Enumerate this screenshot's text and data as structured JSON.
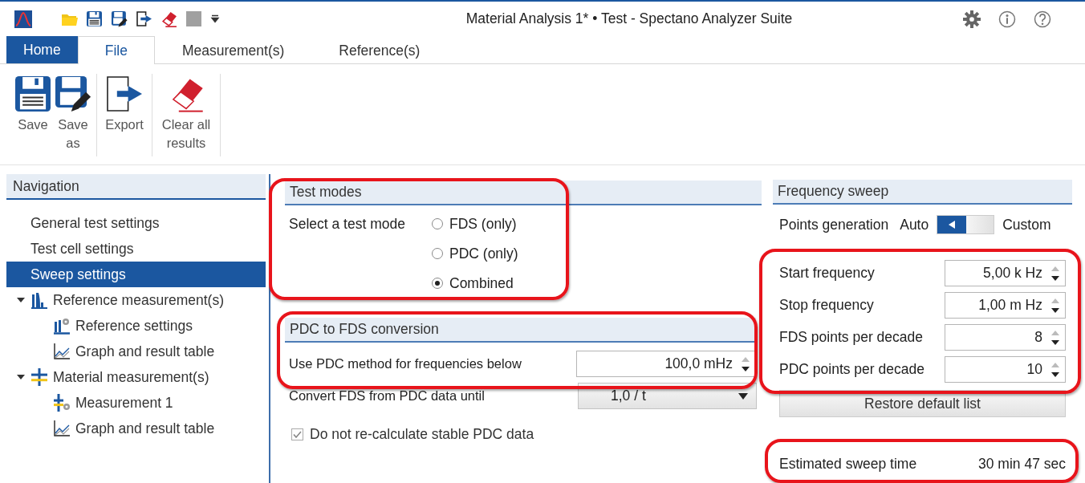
{
  "window": {
    "title": "Material Analysis 1* • Test - Spectano Analyzer Suite"
  },
  "tabs": [
    {
      "label": "Home",
      "selected": false,
      "kind": "app"
    },
    {
      "label": "File",
      "selected": true,
      "kind": "tab"
    },
    {
      "label": "Measurement(s)",
      "selected": false,
      "kind": "tab"
    },
    {
      "label": "Reference(s)",
      "selected": false,
      "kind": "tab"
    }
  ],
  "ribbon": {
    "groups": [
      {
        "buttons": [
          {
            "label": "Save",
            "kind": "save"
          },
          {
            "label": "Save as",
            "kind": "save-as"
          }
        ]
      },
      {
        "buttons": [
          {
            "label": "Export",
            "kind": "export"
          }
        ]
      },
      {
        "buttons": [
          {
            "label": "Clear all results",
            "kind": "clear"
          }
        ]
      }
    ]
  },
  "navigation": {
    "title": "Navigation",
    "items": [
      {
        "label": "General test settings",
        "selected": false
      },
      {
        "label": "Test cell settings",
        "selected": false
      },
      {
        "label": "Sweep settings",
        "selected": true
      },
      {
        "label": "Reference measurement(s)",
        "kind": "reference",
        "selected": false,
        "expanded": true,
        "children": [
          {
            "label": "Reference settings",
            "kind": "reference-settings",
            "selected": false
          },
          {
            "label": "Graph and result table",
            "kind": "graph",
            "selected": false
          }
        ]
      },
      {
        "label": "Material measurement(s)",
        "kind": "material",
        "selected": false,
        "expanded": true,
        "children": [
          {
            "label": "Measurement 1",
            "kind": "measurement",
            "selected": false
          },
          {
            "label": "Graph and result table",
            "kind": "graph",
            "selected": false
          }
        ]
      }
    ]
  },
  "test_modes": {
    "title": "Test modes",
    "label": "Select a test mode",
    "options": [
      {
        "label": "FDS (only)",
        "selected": false
      },
      {
        "label": "PDC (only)",
        "selected": false
      },
      {
        "label": "Combined",
        "selected": true
      }
    ]
  },
  "pdc_conversion": {
    "title": "PDC to FDS conversion",
    "fields": [
      {
        "label": "Use PDC method for frequencies below",
        "value": "100,0 mHz",
        "kind": "spin"
      },
      {
        "label": "Convert FDS from PDC data until",
        "value": "1,0 / t",
        "kind": "dropdown"
      }
    ],
    "checkbox": {
      "label": "Do not re-calculate stable PDC data",
      "checked": true,
      "disabled": true
    }
  },
  "frequency_sweep": {
    "title": "Frequency sweep",
    "points_generation": {
      "label": "Points generation",
      "off_label": "Auto",
      "on_label": "Custom",
      "on": false
    },
    "fields": [
      {
        "label": "Start frequency",
        "value": "5,00 k Hz"
      },
      {
        "label": "Stop frequency",
        "value": "1,00 m Hz"
      },
      {
        "label": "FDS points per decade",
        "value": "8"
      },
      {
        "label": "PDC points per decade",
        "value": "10"
      }
    ],
    "restore_button": "Restore default list",
    "estimated": {
      "label": "Estimated sweep time",
      "value": "30 min 47 sec"
    }
  }
}
